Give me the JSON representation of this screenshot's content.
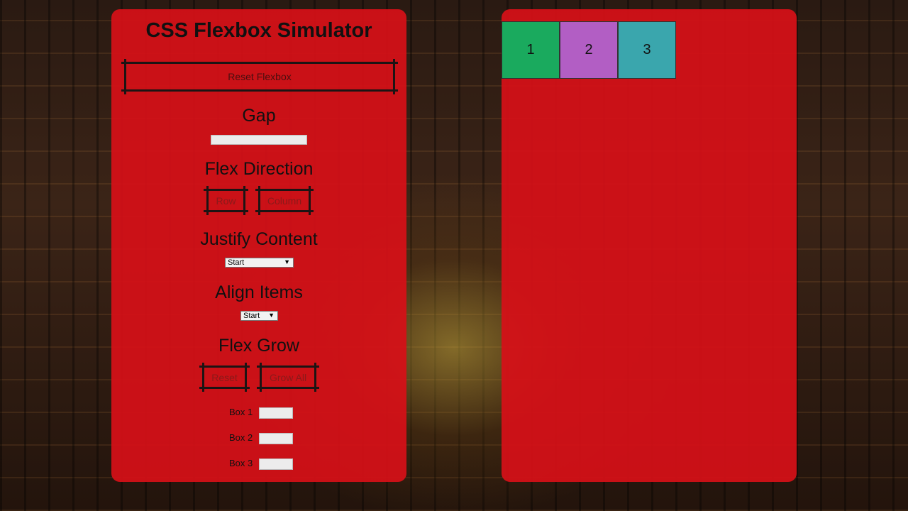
{
  "app": {
    "title": "CSS Flexbox Simulator"
  },
  "controls": {
    "reset_flexbox_label": "Reset Flexbox",
    "gap": {
      "heading": "Gap",
      "value": ""
    },
    "flex_direction": {
      "heading": "Flex Direction",
      "row_label": "Row",
      "column_label": "Column"
    },
    "justify_content": {
      "heading": "Justify Content",
      "selected": "Start"
    },
    "align_items": {
      "heading": "Align Items",
      "selected": "Start"
    },
    "flex_grow": {
      "heading": "Flex Grow",
      "reset_label": "Reset",
      "grow_all_label": "Grow All",
      "boxes": [
        {
          "label": "Box 1",
          "value": ""
        },
        {
          "label": "Box 2",
          "value": ""
        },
        {
          "label": "Box 3",
          "value": ""
        }
      ]
    }
  },
  "preview": {
    "boxes": [
      {
        "label": "1",
        "color": "#1aaa5e"
      },
      {
        "label": "2",
        "color": "#b25ec4"
      },
      {
        "label": "3",
        "color": "#3aa6ad"
      }
    ]
  },
  "colors": {
    "panel": "#d61018"
  }
}
